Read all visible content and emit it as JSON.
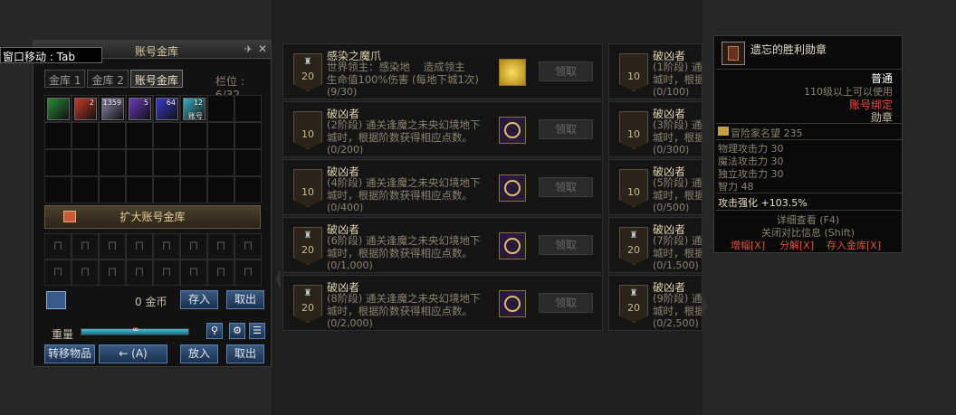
{
  "warehouse": {
    "title": "账号金库",
    "tooltip": "窗口移动 : Tab",
    "tabs": [
      "金库 1",
      "金库 2",
      "账号金库"
    ],
    "slots": "栏位 : 6/32",
    "items": [
      {
        "icon": "green-blade-icon",
        "color": "#2a8a3a",
        "count": ""
      },
      {
        "icon": "red-scroll-icon",
        "color": "#c83a2a",
        "count": "2"
      },
      {
        "icon": "silver-orb-icon",
        "color": "#8a8ab0",
        "count": "1359"
      },
      {
        "icon": "purple-gem-icon",
        "color": "#6a3ac0",
        "count": "5"
      },
      {
        "icon": "blue-orb-icon",
        "color": "#3a3ad0",
        "count": "64"
      },
      {
        "icon": "cyan-crystal-icon",
        "color": "#3ab0c0",
        "count": "12",
        "tag": "账号"
      }
    ],
    "expand_label": "扩大账号金库",
    "gold": "0 金币",
    "deposit": "存入",
    "withdraw": "取出",
    "weight_label": "重量",
    "weight_value": "∞",
    "weight_fill": 1.0,
    "transfer": "转移物品",
    "shortcut": "← (A)",
    "put": "放入",
    "take": "取出"
  },
  "achievements_left": [
    {
      "badge": "20",
      "cup": true,
      "title": "感染之魔爪",
      "desc": "世界领主：感染地    造成领主\n生命值100%伤害 (每地下城1次)",
      "progress": "(9/30)",
      "reward": "gold",
      "claim": "领取"
    },
    {
      "badge": "10",
      "cup": false,
      "title": "破凶者",
      "desc": "(2阶段) 通关逢魔之未央幻境地下\n城时，根据阶数获得相应点数。",
      "progress": "(0/200)",
      "reward": "emblem",
      "claim": "领取"
    },
    {
      "badge": "10",
      "cup": false,
      "title": "破凶者",
      "desc": "(4阶段) 通关逢魔之未央幻境地下\n城时，根据阶数获得相应点数。",
      "progress": "(0/400)",
      "reward": "emblem",
      "claim": "领取"
    },
    {
      "badge": "20",
      "cup": true,
      "title": "破凶者",
      "desc": "(6阶段) 通关逢魔之未央幻境地下\n城时，根据阶数获得相应点数。",
      "progress": "(0/1,000)",
      "reward": "emblem",
      "claim": "领取"
    },
    {
      "badge": "20",
      "cup": true,
      "title": "破凶者",
      "desc": "(8阶段) 通关逢魔之未央幻境地下\n城时，根据阶数获得相应点数。",
      "progress": "(0/2,000)",
      "reward": "emblem",
      "claim": "领取"
    }
  ],
  "achievements_right": [
    {
      "badge": "10",
      "cup": false,
      "title": "破凶者",
      "desc": "(1阶段) 通\n城时，根据",
      "progress": "(0/100)"
    },
    {
      "badge": "10",
      "cup": false,
      "title": "破凶者",
      "desc": "(3阶段) 通\n城时，根据",
      "progress": "(0/300)"
    },
    {
      "badge": "10",
      "cup": false,
      "title": "破凶者",
      "desc": "(5阶段) 通\n城时，根据",
      "progress": "(0/500)"
    },
    {
      "badge": "20",
      "cup": true,
      "title": "破凶者",
      "desc": "(7阶段) 通\n城时，根据",
      "progress": "(0/1,500)"
    },
    {
      "badge": "20",
      "cup": true,
      "title": "破凶者",
      "desc": "(9阶段) 通\n城时，根据",
      "progress": "(0/2,500)"
    }
  ],
  "tooltip_item": {
    "name": "遗忘的胜利勋章",
    "rarity": "普通",
    "level_req": "110级以上可以使用",
    "bind": "账号绑定",
    "type": "勋章",
    "fame": "冒险家名望 235",
    "stats": [
      "物理攻击力 30",
      "魔法攻击力 30",
      "独立攻击力 30",
      "智力 48"
    ],
    "enhance": "攻击强化 +103.5%",
    "detail": "详细查看 (F4)",
    "compare": "关闭对比信息 (Shift)",
    "amplify": "增幅[X]",
    "disassemble": "分解[X]",
    "store": "存入金库[X]",
    "colors": {
      "rarity": "#ffffff",
      "bind": "#e05040",
      "action": "#e05040",
      "text": "#c8c0a8"
    }
  }
}
